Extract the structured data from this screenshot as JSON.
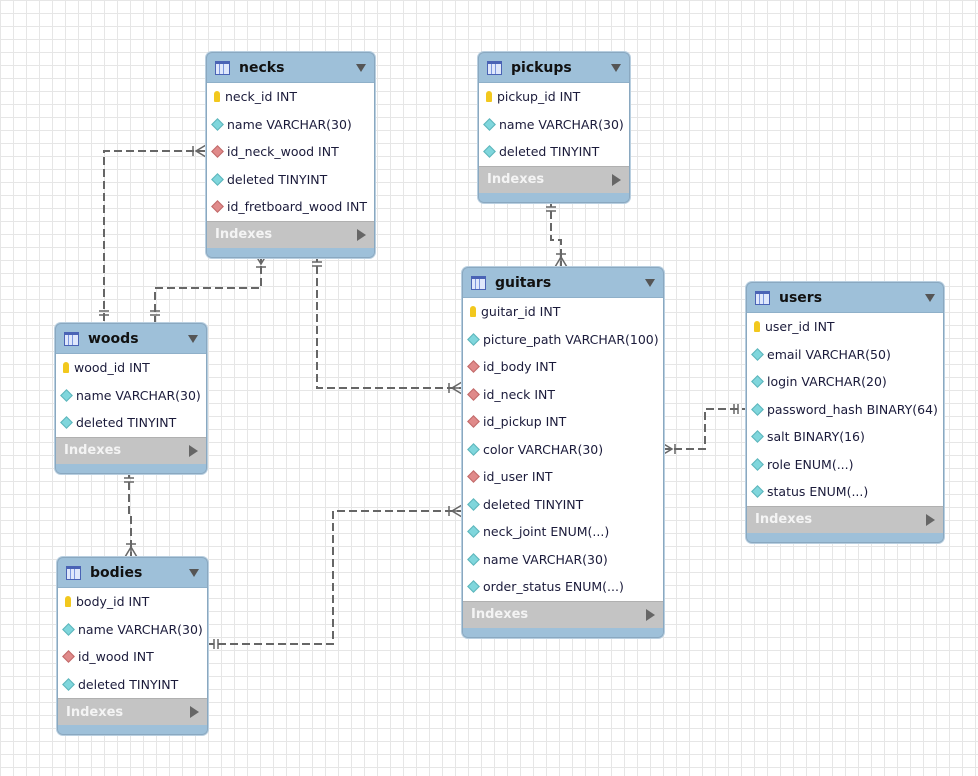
{
  "diagram": {
    "indexes_label": "Indexes",
    "colors": {
      "header": "#9ec0d9",
      "indexes": "#c4c4c4",
      "link": "#666666"
    },
    "tables": [
      {
        "id": "necks",
        "name": "necks",
        "columns": [
          {
            "text": "neck_id INT",
            "kind": "pk"
          },
          {
            "text": "name VARCHAR(30)",
            "kind": "col"
          },
          {
            "text": "id_neck_wood INT",
            "kind": "fk"
          },
          {
            "text": "deleted TINYINT",
            "kind": "col"
          },
          {
            "text": "id_fretboard_wood INT",
            "kind": "fk"
          }
        ]
      },
      {
        "id": "pickups",
        "name": "pickups",
        "columns": [
          {
            "text": "pickup_id INT",
            "kind": "pk"
          },
          {
            "text": "name VARCHAR(30)",
            "kind": "col"
          },
          {
            "text": "deleted TINYINT",
            "kind": "col"
          }
        ]
      },
      {
        "id": "woods",
        "name": "woods",
        "columns": [
          {
            "text": "wood_id INT",
            "kind": "pk"
          },
          {
            "text": "name VARCHAR(30)",
            "kind": "col"
          },
          {
            "text": "deleted TINYINT",
            "kind": "col"
          }
        ]
      },
      {
        "id": "bodies",
        "name": "bodies",
        "columns": [
          {
            "text": "body_id INT",
            "kind": "pk"
          },
          {
            "text": "name VARCHAR(30)",
            "kind": "col"
          },
          {
            "text": "id_wood INT",
            "kind": "fk"
          },
          {
            "text": "deleted TINYINT",
            "kind": "col"
          }
        ]
      },
      {
        "id": "guitars",
        "name": "guitars",
        "columns": [
          {
            "text": "guitar_id INT",
            "kind": "pk"
          },
          {
            "text": "picture_path VARCHAR(100)",
            "kind": "col"
          },
          {
            "text": "id_body INT",
            "kind": "fk"
          },
          {
            "text": "id_neck INT",
            "kind": "fk"
          },
          {
            "text": "id_pickup INT",
            "kind": "fk"
          },
          {
            "text": "color VARCHAR(30)",
            "kind": "col"
          },
          {
            "text": "id_user INT",
            "kind": "fk"
          },
          {
            "text": "deleted TINYINT",
            "kind": "col"
          },
          {
            "text": "neck_joint ENUM(...)",
            "kind": "col"
          },
          {
            "text": "name VARCHAR(30)",
            "kind": "col"
          },
          {
            "text": "order_status ENUM(...)",
            "kind": "col"
          }
        ]
      },
      {
        "id": "users",
        "name": "users",
        "columns": [
          {
            "text": "user_id INT",
            "kind": "pk"
          },
          {
            "text": "email VARCHAR(50)",
            "kind": "col"
          },
          {
            "text": "login VARCHAR(20)",
            "kind": "col"
          },
          {
            "text": "password_hash BINARY(64)",
            "kind": "col"
          },
          {
            "text": "salt BINARY(16)",
            "kind": "col"
          },
          {
            "text": "role ENUM(...)",
            "kind": "col"
          },
          {
            "text": "status ENUM(...)",
            "kind": "col"
          }
        ]
      }
    ],
    "relationships": [
      {
        "from": "necks",
        "to": "woods",
        "label": "id_neck_wood"
      },
      {
        "from": "necks",
        "to": "woods",
        "label": "id_fretboard_wood"
      },
      {
        "from": "guitars",
        "to": "necks",
        "label": "id_neck"
      },
      {
        "from": "guitars",
        "to": "pickups",
        "label": "id_pickup"
      },
      {
        "from": "bodies",
        "to": "woods",
        "label": "id_wood"
      },
      {
        "from": "guitars",
        "to": "bodies",
        "label": "id_body"
      },
      {
        "from": "guitars",
        "to": "users",
        "label": "id_user"
      }
    ]
  }
}
